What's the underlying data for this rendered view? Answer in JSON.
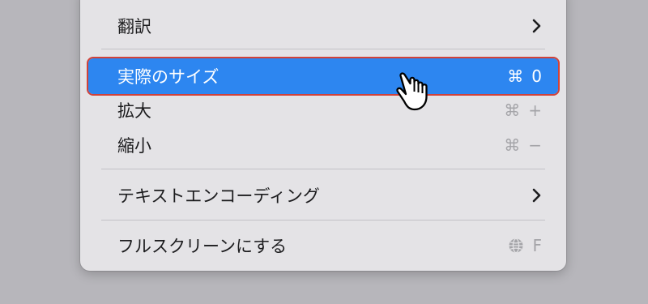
{
  "menu": {
    "items": [
      {
        "label": "翻訳",
        "shortcut": null,
        "submenu": true
      },
      {
        "label": "実際のサイズ",
        "shortcut_symbol": "⌘",
        "shortcut_key": "0",
        "selected": true
      },
      {
        "label": "拡大",
        "shortcut_symbol": "⌘",
        "shortcut_key": "+"
      },
      {
        "label": "縮小",
        "shortcut_symbol": "⌘",
        "shortcut_key": "−"
      },
      {
        "label": "テキストエンコーディング",
        "submenu": true
      },
      {
        "label": "フルスクリーンにする",
        "shortcut_icon": "globe-icon",
        "shortcut_key": "F"
      }
    ]
  },
  "colors": {
    "highlight": "#2d86f0",
    "highlight_outline": "#d0423a",
    "menu_background": "#e4e3e6",
    "backdrop": "#b7b6bb"
  },
  "cursor": {
    "icon": "pointing-hand-cursor-icon"
  }
}
